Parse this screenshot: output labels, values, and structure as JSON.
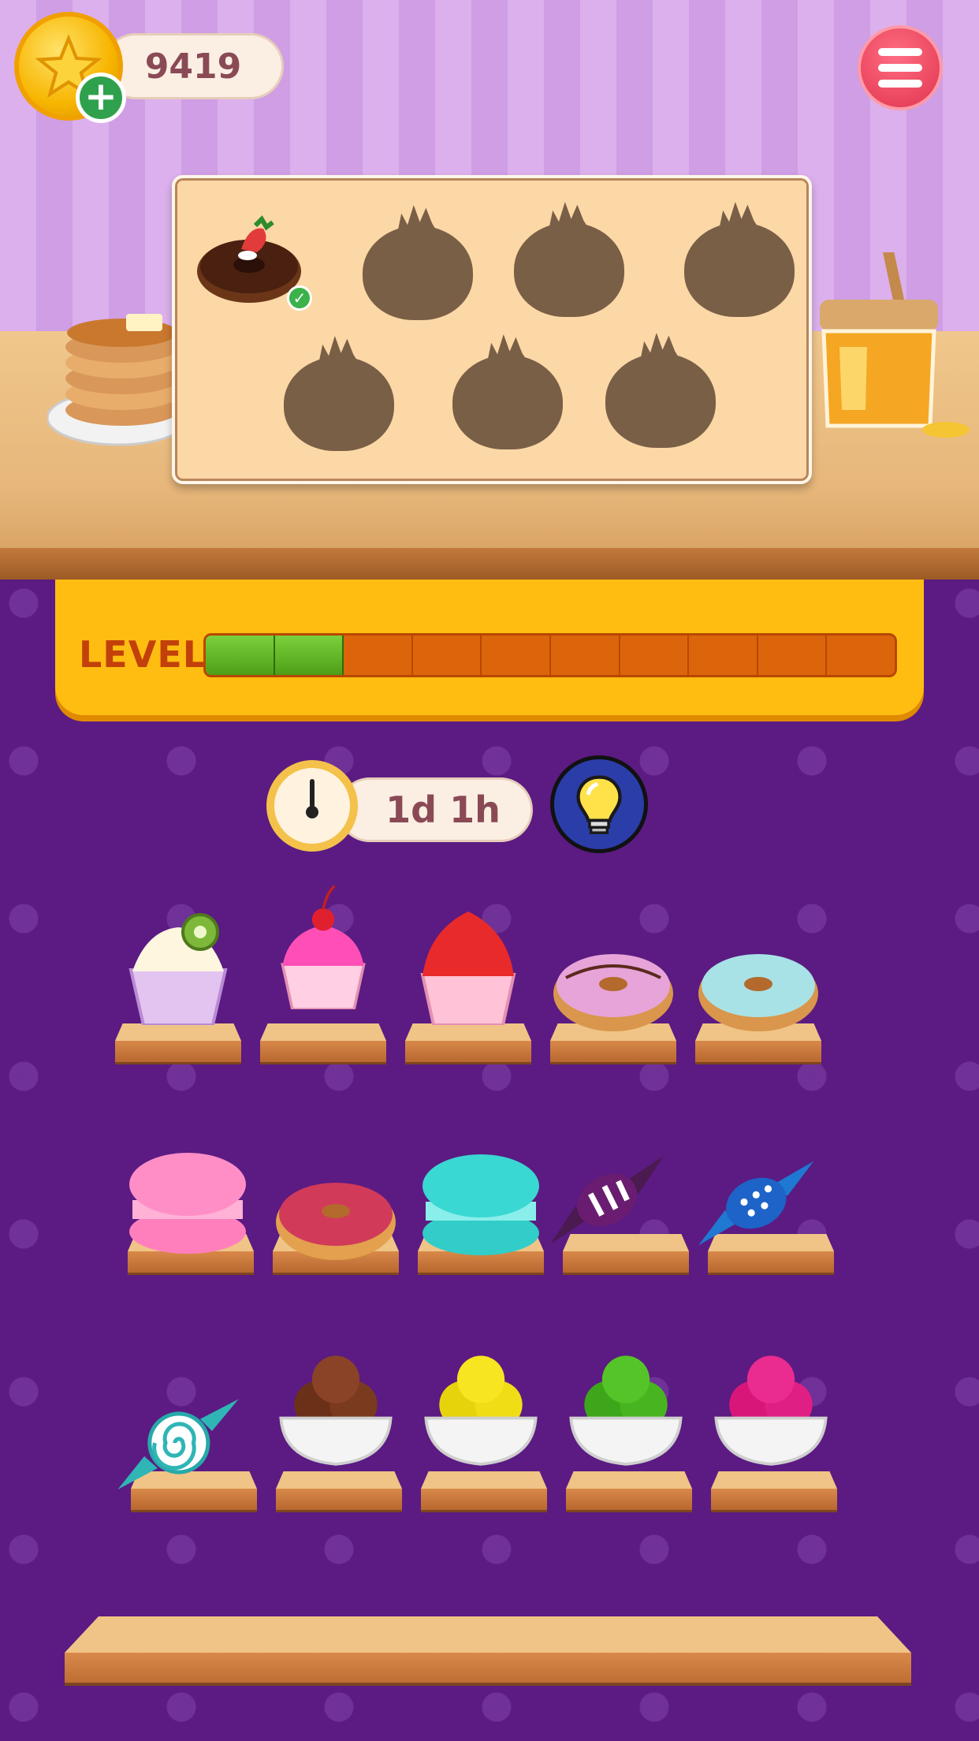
{
  "hud": {
    "coins": "9419",
    "coin_icon": "star-coin-icon",
    "add_icon": "plus-icon",
    "menu_icon": "hamburger-menu-icon"
  },
  "level": {
    "label": "LEVEL",
    "segments_total": 10,
    "segments_filled": 2,
    "fill_color": "#5fb21f",
    "empty_color": "#dc650c"
  },
  "timer": {
    "value": "1d 1h",
    "icon": "clock-icon"
  },
  "hint": {
    "icon": "light-bulb-icon"
  },
  "target": {
    "collected": 1,
    "total": 7,
    "items": [
      {
        "name": "chocolate-strawberry-donut",
        "collected": true
      },
      {
        "name": "hidden-item",
        "collected": false
      },
      {
        "name": "hidden-item",
        "collected": false
      },
      {
        "name": "hidden-item",
        "collected": false
      },
      {
        "name": "hidden-item",
        "collected": false
      },
      {
        "name": "hidden-item",
        "collected": false
      },
      {
        "name": "hidden-item",
        "collected": false
      }
    ]
  },
  "shelves": [
    [
      "kiwi-cupcake",
      "cherry-cupcake",
      "red-cupcake",
      "purple-donut",
      "blue-donut"
    ],
    [
      "pink-macaron",
      "pink-donut",
      "teal-macaron",
      "purple-striped-candy",
      "blue-dotted-candy"
    ],
    [
      "teal-swirl-candy",
      "chocolate-ice-cream-bowl",
      "yellow-ice-cream-bowl",
      "green-ice-cream-bowl",
      "pink-ice-cream-bowl"
    ]
  ],
  "colors": {
    "wall": "#d8aaea",
    "board": "#5b1b82",
    "level_panel": "#ffbd12",
    "menu_button": "#e8445e"
  }
}
